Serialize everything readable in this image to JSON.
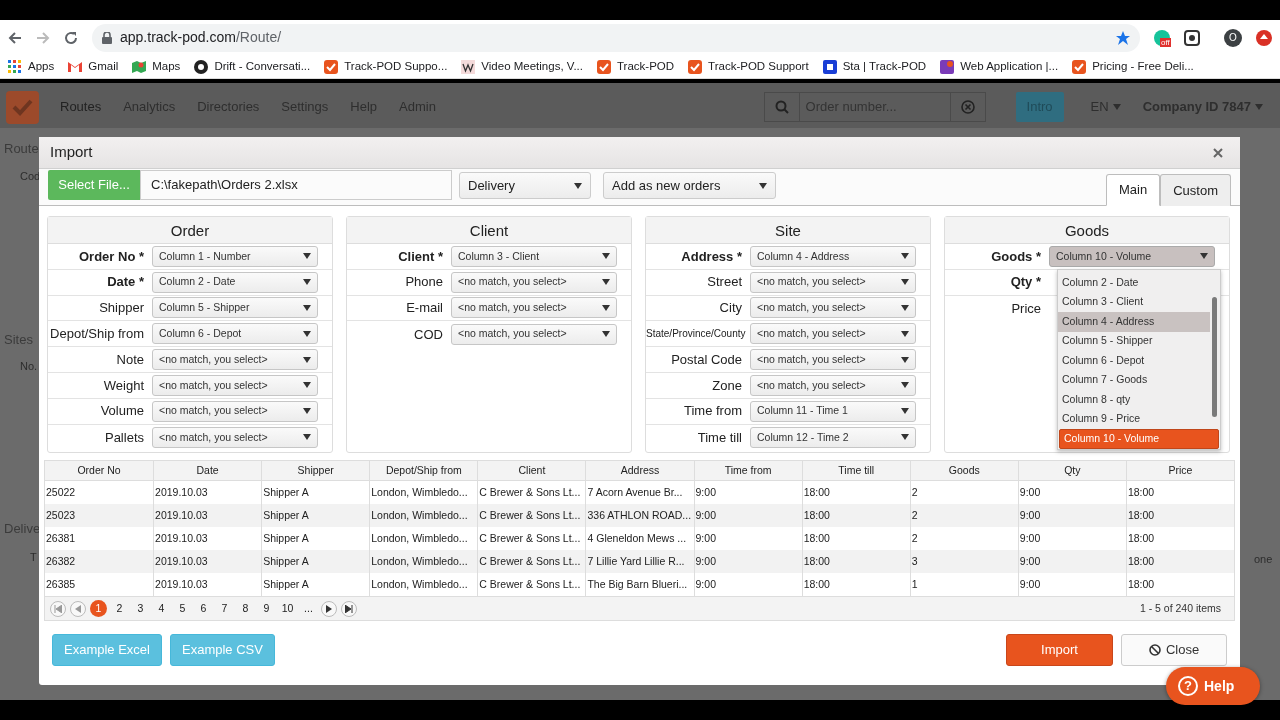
{
  "browser": {
    "url_host": "app.track-pod.com",
    "url_path": "/Route/",
    "extension_badge": "off",
    "profile_initial": "O",
    "bookmarks": [
      {
        "label": "Apps",
        "kind": "apps"
      },
      {
        "label": "Gmail",
        "kind": "mail"
      },
      {
        "label": "Maps",
        "kind": "maps"
      },
      {
        "label": "Drift - Conversati...",
        "kind": "drift"
      },
      {
        "label": "Track-POD Suppo...",
        "kind": "trackpod"
      },
      {
        "label": "Video Meetings, V...",
        "kind": "wiki"
      },
      {
        "label": "Track-POD",
        "kind": "trackpod"
      },
      {
        "label": "Track-POD Support",
        "kind": "trackpod"
      },
      {
        "label": "Sta | Track-POD",
        "kind": "sta"
      },
      {
        "label": "Web Application |...",
        "kind": "webapp"
      },
      {
        "label": "Pricing - Free Deli...",
        "kind": "trackpod"
      }
    ]
  },
  "app_nav": {
    "items": [
      {
        "label": "Routes",
        "selected": true
      },
      {
        "label": "Analytics",
        "selected": false
      },
      {
        "label": "Directories",
        "selected": false
      },
      {
        "label": "Settings",
        "selected": false
      },
      {
        "label": "Help",
        "selected": false
      },
      {
        "label": "Admin",
        "selected": false
      }
    ],
    "search_placeholder": "Order number...",
    "intro_button": "Intro",
    "language": "EN",
    "company": "Company ID 7847"
  },
  "background": {
    "left": [
      {
        "text": "Route",
        "kind": "title"
      },
      {
        "text": "Cod",
        "kind": "header"
      },
      {
        "text": "Sites",
        "kind": "title"
      },
      {
        "text": "No.",
        "kind": "header"
      },
      {
        "text": "Delive",
        "kind": "title"
      },
      {
        "text": "T",
        "kind": "header"
      }
    ],
    "right": "one"
  },
  "modal": {
    "title": "Import",
    "file_button": "Select File...",
    "file_path": "C:\\fakepath\\Orders 2.xlsx",
    "type_select": "Delivery",
    "mode_select": "Add as new orders",
    "tabs": [
      {
        "label": "Main",
        "selected": true
      },
      {
        "label": "Custom",
        "selected": false
      }
    ],
    "sections": [
      {
        "title": "Order",
        "fields": [
          {
            "label": "Order No *",
            "required": true,
            "value": "Column 1 - Number"
          },
          {
            "label": "Date *",
            "required": true,
            "value": "Column 2 - Date"
          },
          {
            "label": "Shipper",
            "required": false,
            "value": "Column 5 - Shipper"
          },
          {
            "label": "Depot/Ship from",
            "required": false,
            "value": "Column 6 - Depot"
          },
          {
            "label": "Note",
            "required": false,
            "value": "<no match, you select>"
          },
          {
            "label": "Weight",
            "required": false,
            "value": "<no match, you select>"
          },
          {
            "label": "Volume",
            "required": false,
            "value": "<no match, you select>"
          },
          {
            "label": "Pallets",
            "required": false,
            "value": "<no match, you select>"
          }
        ]
      },
      {
        "title": "Client",
        "fields": [
          {
            "label": "Client *",
            "required": true,
            "value": "Column 3 - Client"
          },
          {
            "label": "Phone",
            "required": false,
            "value": "<no match, you select>"
          },
          {
            "label": "E-mail",
            "required": false,
            "value": "<no match, you select>"
          },
          {
            "label": "COD",
            "required": false,
            "value": "<no match, you select>"
          }
        ]
      },
      {
        "title": "Site",
        "fields": [
          {
            "label": "Address *",
            "required": true,
            "value": "Column 4 - Address"
          },
          {
            "label": "Street",
            "required": false,
            "value": "<no match, you select>"
          },
          {
            "label": "City",
            "required": false,
            "value": "<no match, you select>"
          },
          {
            "label": "State/Province/County",
            "required": false,
            "value": "<no match, you select>"
          },
          {
            "label": "Postal Code",
            "required": false,
            "value": "<no match, you select>"
          },
          {
            "label": "Zone",
            "required": false,
            "value": "<no match, you select>"
          },
          {
            "label": "Time from",
            "required": false,
            "value": "Column 11 - Time 1"
          },
          {
            "label": "Time till",
            "required": false,
            "value": "Column 12 - Time 2"
          }
        ]
      },
      {
        "title": "Goods",
        "fields": [
          {
            "label": "Goods *",
            "required": true,
            "value": "Column 10 - Volume",
            "expanded": true,
            "options": [
              {
                "label": "Column 2 - Date",
                "hovered": false,
                "selected": false
              },
              {
                "label": "Column 3 - Client",
                "hovered": false,
                "selected": false
              },
              {
                "label": "Column 4 - Address",
                "hovered": true,
                "selected": false
              },
              {
                "label": "Column 5 - Shipper",
                "hovered": false,
                "selected": false
              },
              {
                "label": "Column 6 - Depot",
                "hovered": false,
                "selected": false
              },
              {
                "label": "Column 7 - Goods",
                "hovered": false,
                "selected": false
              },
              {
                "label": "Column 8 - qty",
                "hovered": false,
                "selected": false
              },
              {
                "label": "Column 9 - Price",
                "hovered": false,
                "selected": false
              },
              {
                "label": "Column 10 - Volume",
                "hovered": false,
                "selected": true
              }
            ]
          },
          {
            "label": "Qty *",
            "required": true
          },
          {
            "label": "Price",
            "required": false
          }
        ]
      }
    ],
    "table": {
      "columns": [
        "Order No",
        "Date",
        "Shipper",
        "Depot/Ship from",
        "Client",
        "Address",
        "Time from",
        "Time till",
        "Goods",
        "Qty",
        "Price"
      ],
      "rows": [
        [
          "25022",
          "2019.10.03",
          "Shipper A",
          "London, Wimbledo...",
          "C Brewer & Sons Lt...",
          "7 Acorn Avenue Br...",
          "9:00",
          "18:00",
          "2",
          "9:00",
          "18:00"
        ],
        [
          "25023",
          "2019.10.03",
          "Shipper A",
          "London, Wimbledo...",
          "C Brewer & Sons Lt...",
          "336 ATHLON ROAD...",
          "9:00",
          "18:00",
          "2",
          "9:00",
          "18:00"
        ],
        [
          "26381",
          "2019.10.03",
          "Shipper A",
          "London, Wimbledo...",
          "C Brewer & Sons Lt...",
          "4 Gleneldon Mews ...",
          "9:00",
          "18:00",
          "2",
          "9:00",
          "18:00"
        ],
        [
          "26382",
          "2019.10.03",
          "Shipper A",
          "London, Wimbledo...",
          "C Brewer & Sons Lt...",
          "7 Lillie Yard Lillie R...",
          "9:00",
          "18:00",
          "3",
          "9:00",
          "18:00"
        ],
        [
          "26385",
          "2019.10.03",
          "Shipper A",
          "London, Wimbledo...",
          "C Brewer & Sons Lt...",
          "The Big Barn Blueri...",
          "9:00",
          "18:00",
          "1",
          "9:00",
          "18:00"
        ]
      ]
    },
    "pager": {
      "pages": [
        {
          "label": "1",
          "selected": true
        },
        {
          "label": "2",
          "selected": false
        },
        {
          "label": "3",
          "selected": false
        },
        {
          "label": "4",
          "selected": false
        },
        {
          "label": "5",
          "selected": false
        },
        {
          "label": "6",
          "selected": false
        },
        {
          "label": "7",
          "selected": false
        },
        {
          "label": "8",
          "selected": false
        },
        {
          "label": "9",
          "selected": false
        },
        {
          "label": "10",
          "selected": false
        },
        {
          "label": "...",
          "selected": false
        }
      ],
      "summary": "1 - 5 of 240 items"
    },
    "footer": [
      {
        "label": "Example Excel",
        "kind": "info"
      },
      {
        "label": "Example CSV",
        "kind": "info"
      },
      {
        "label": "Import",
        "kind": "primary"
      },
      {
        "label": "Close",
        "kind": "close"
      }
    ]
  },
  "help_button": {
    "icon": "?",
    "label": "Help"
  }
}
